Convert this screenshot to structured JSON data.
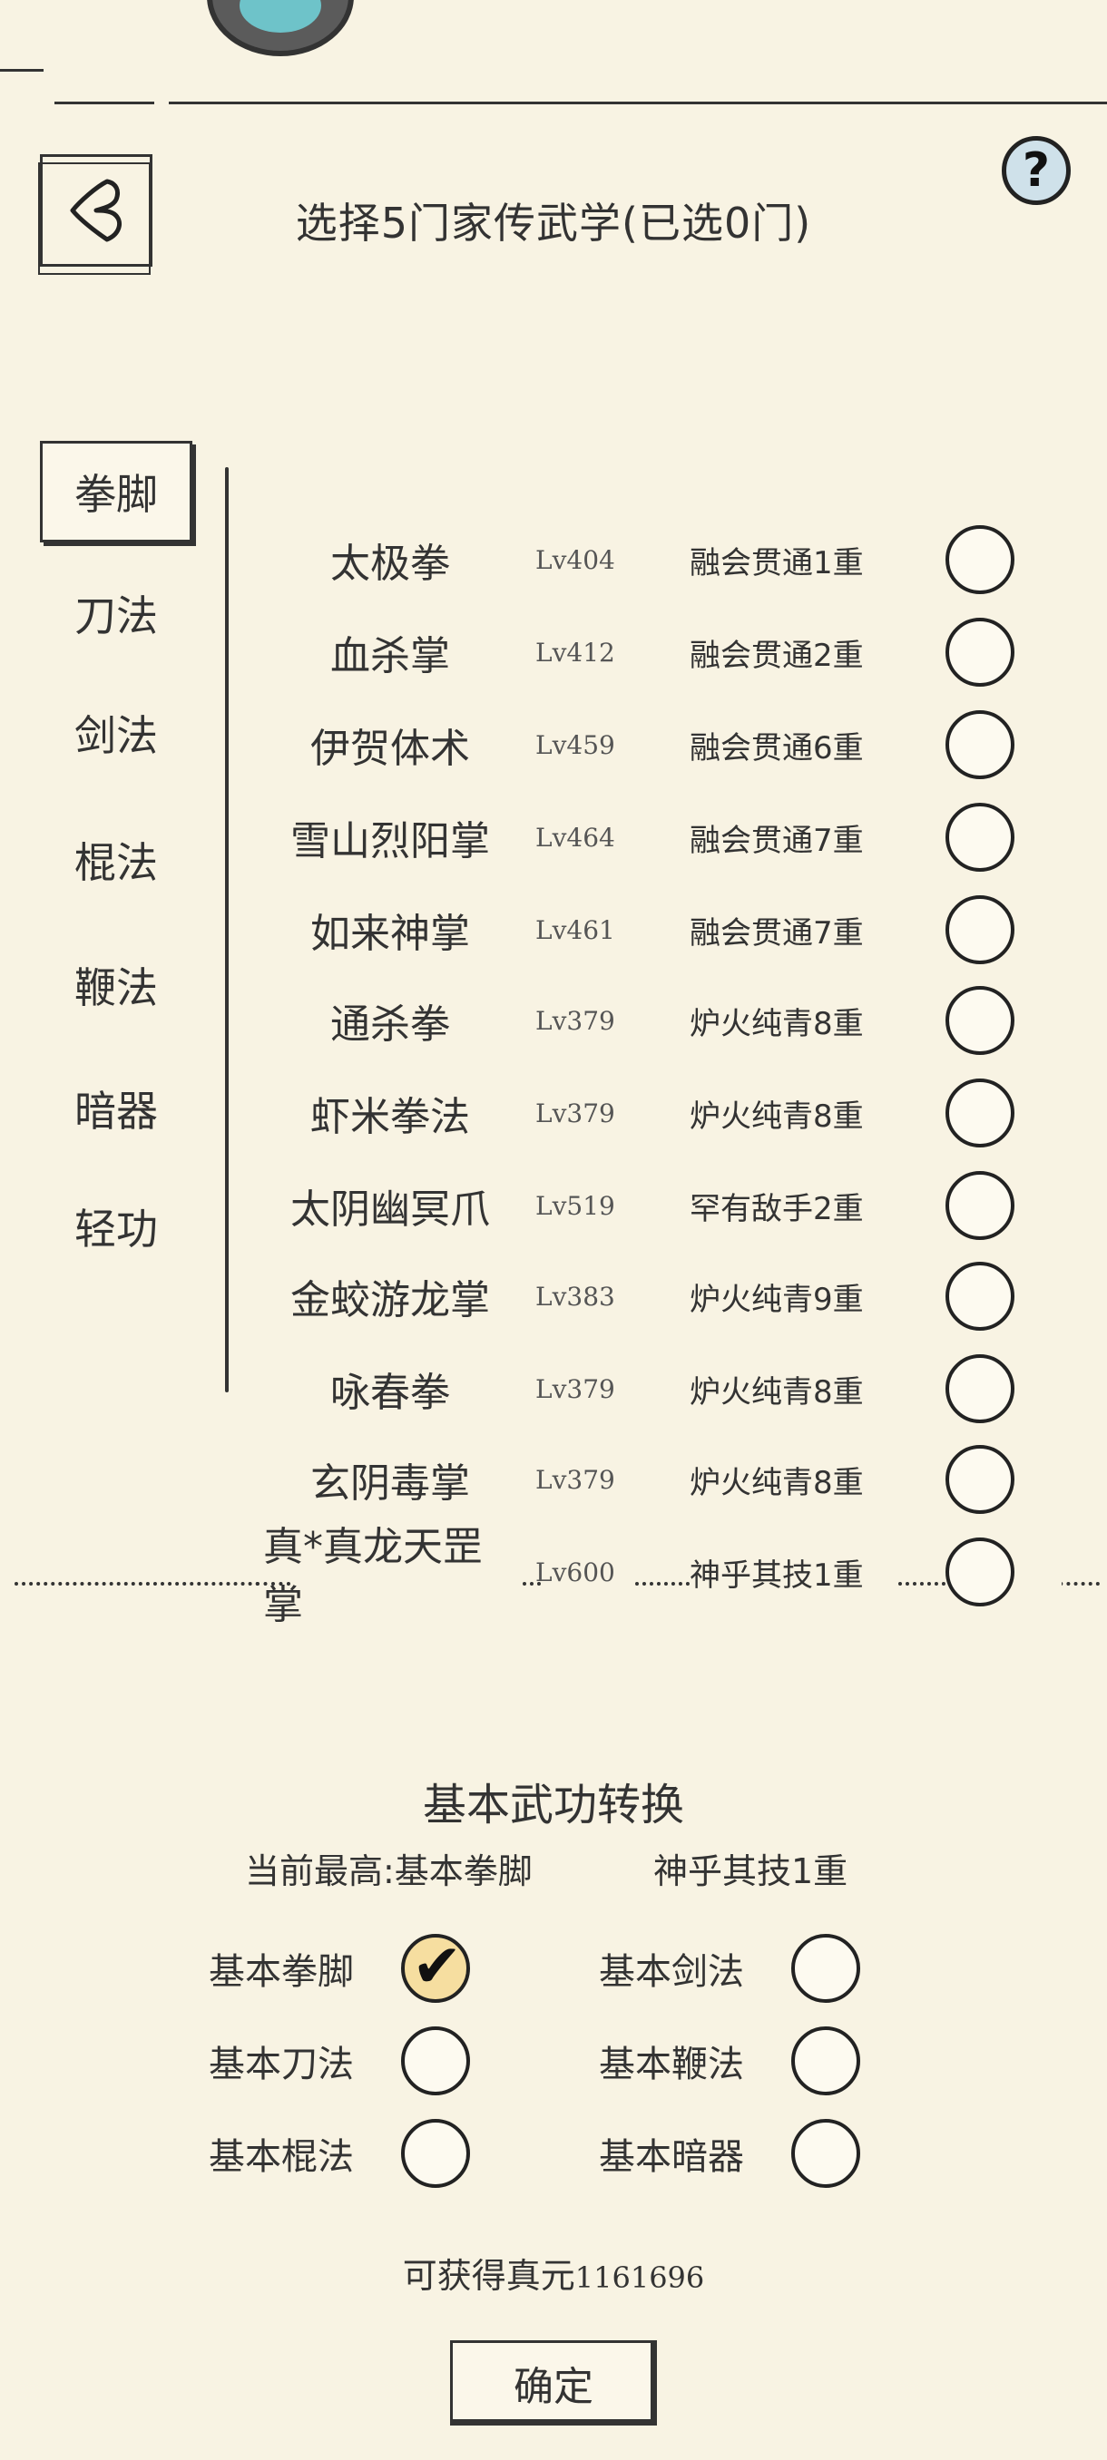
{
  "header": {
    "title": "选择5门家传武学(已选0门)",
    "help_label": "?"
  },
  "categories": [
    {
      "label": "拳脚",
      "active": true
    },
    {
      "label": "刀法",
      "active": false
    },
    {
      "label": "剑法",
      "active": false
    },
    {
      "label": "棍法",
      "active": false
    },
    {
      "label": "鞭法",
      "active": false
    },
    {
      "label": "暗器",
      "active": false
    },
    {
      "label": "轻功",
      "active": false
    }
  ],
  "skills": [
    {
      "name": "太极拳",
      "level": "Lv404",
      "rank": "融会贯通1重",
      "selected": false
    },
    {
      "name": "血杀掌",
      "level": "Lv412",
      "rank": "融会贯通2重",
      "selected": false
    },
    {
      "name": "伊贺体术",
      "level": "Lv459",
      "rank": "融会贯通6重",
      "selected": false
    },
    {
      "name": "雪山烈阳掌",
      "level": "Lv464",
      "rank": "融会贯通7重",
      "selected": false
    },
    {
      "name": "如来神掌",
      "level": "Lv461",
      "rank": "融会贯通7重",
      "selected": false
    },
    {
      "name": "通杀拳",
      "level": "Lv379",
      "rank": "炉火纯青8重",
      "selected": false
    },
    {
      "name": "虾米拳法",
      "level": "Lv379",
      "rank": "炉火纯青8重",
      "selected": false
    },
    {
      "name": "太阴幽冥爪",
      "level": "Lv519",
      "rank": "罕有敌手2重",
      "selected": false
    },
    {
      "name": "金蛟游龙掌",
      "level": "Lv383",
      "rank": "炉火纯青9重",
      "selected": false
    },
    {
      "name": "咏春拳",
      "level": "Lv379",
      "rank": "炉火纯青8重",
      "selected": false
    },
    {
      "name": "玄阴毒掌",
      "level": "Lv379",
      "rank": "炉火纯青8重",
      "selected": false
    },
    {
      "name": "真*真龙天罡掌",
      "level": "Lv600",
      "rank": "神乎其技1重",
      "selected": false
    }
  ],
  "conversion": {
    "title": "基本武功转换",
    "current_label": "当前最高:基本拳脚",
    "current_rank": "神乎其技1重",
    "options": [
      {
        "label": "基本拳脚",
        "checked": true
      },
      {
        "label": "基本剑法",
        "checked": false
      },
      {
        "label": "基本刀法",
        "checked": false
      },
      {
        "label": "基本鞭法",
        "checked": false
      },
      {
        "label": "基本棍法",
        "checked": false
      },
      {
        "label": "基本暗器",
        "checked": false
      }
    ],
    "zhenyuan_label": "可获得真元",
    "zhenyuan_value": "1161696",
    "confirm_label": "确定"
  }
}
